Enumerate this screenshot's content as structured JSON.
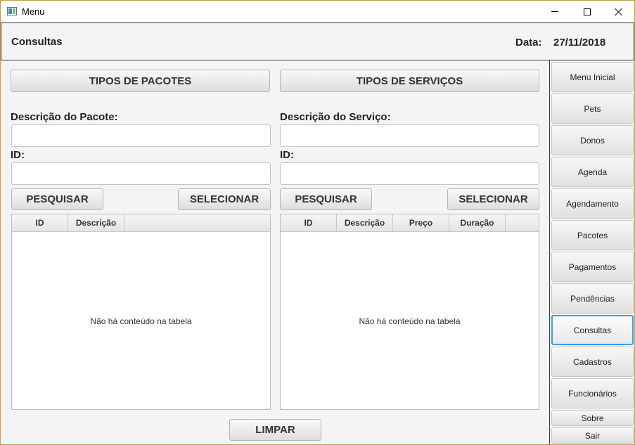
{
  "window": {
    "title": "Menu"
  },
  "header": {
    "title": "Consultas",
    "date_label": "Data:",
    "date_value": "27/11/2018"
  },
  "left_panel": {
    "section_button": "TIPOS DE PACOTES",
    "description_label": "Descrição do Pacote:",
    "description_value": "",
    "id_label": "ID:",
    "id_value": "",
    "search_button": "PESQUISAR",
    "select_button": "SELECIONAR",
    "table": {
      "columns": [
        "ID",
        "Descrição"
      ],
      "empty_message": "Não há conteúdo na tabela"
    }
  },
  "right_panel": {
    "section_button": "TIPOS DE SERVIÇOS",
    "description_label": "Descrição do Serviço:",
    "description_value": "",
    "id_label": "ID:",
    "id_value": "",
    "search_button": "PESQUISAR",
    "select_button": "SELECIONAR",
    "table": {
      "columns": [
        "ID",
        "Descrição",
        "Preço",
        "Duração"
      ],
      "empty_message": "Não há conteúdo na tabela"
    }
  },
  "clear_button": "LIMPAR",
  "sidebar": {
    "items": [
      {
        "label": "Menu Inicial"
      },
      {
        "label": "Pets"
      },
      {
        "label": "Donos"
      },
      {
        "label": "Agenda"
      },
      {
        "label": "Agendamento"
      },
      {
        "label": "Pacotes"
      },
      {
        "label": "Pagamentos"
      },
      {
        "label": "Pendências"
      },
      {
        "label": "Consultas",
        "active": true
      },
      {
        "label": "Cadastros"
      },
      {
        "label": "Funcionários"
      },
      {
        "label": "Sobre"
      },
      {
        "label": "Sair"
      }
    ]
  },
  "colors": {
    "active_border": "#3d9be9",
    "window_border": "#c69b4b"
  }
}
